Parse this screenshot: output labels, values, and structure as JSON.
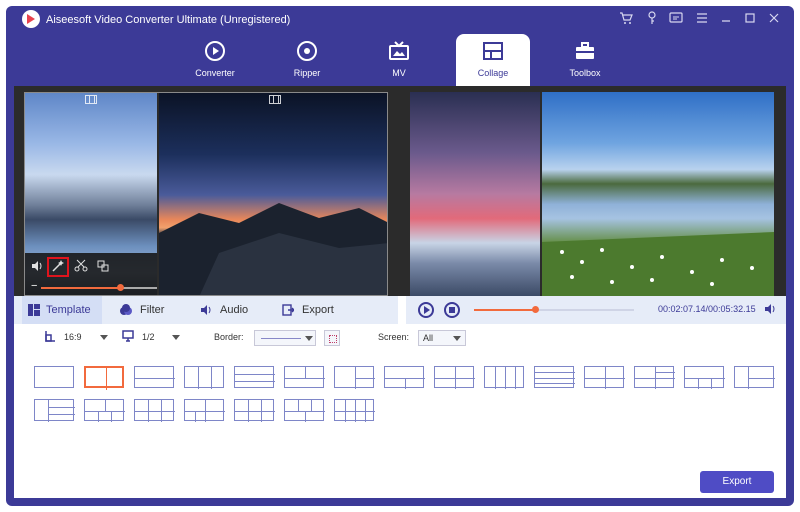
{
  "window": {
    "title": "Aiseesoft Video Converter Ultimate (Unregistered)"
  },
  "titlebar_icons": [
    "cart-icon",
    "key-icon",
    "feedback-icon",
    "menu-icon",
    "minimize-icon",
    "maximize-icon",
    "close-icon"
  ],
  "nav": {
    "tabs": [
      {
        "label": "Converter",
        "icon": "converter-icon"
      },
      {
        "label": "Ripper",
        "icon": "ripper-icon"
      },
      {
        "label": "MV",
        "icon": "mv-icon"
      },
      {
        "label": "Collage",
        "icon": "collage-icon",
        "active": true
      },
      {
        "label": "Toolbox",
        "icon": "toolbox-icon"
      }
    ]
  },
  "preview": {
    "edit_bar": {
      "icons": [
        "volume-icon",
        "magic-wand-icon",
        "scissors-icon",
        "crop-icon"
      ],
      "highlighted": "magic-wand-icon",
      "volume_level": 0.6
    }
  },
  "bottom_tabs": [
    {
      "label": "Template",
      "icon": "template-icon",
      "active": true
    },
    {
      "label": "Filter",
      "icon": "filter-icon"
    },
    {
      "label": "Audio",
      "icon": "audio-icon"
    },
    {
      "label": "Export",
      "icon": "export-icon"
    }
  ],
  "player": {
    "time": "00:02:07.14/00:05:32.15",
    "progress": 0.38
  },
  "options": {
    "aspect_ratio": "16:9",
    "screen_split": "1/2",
    "border_label": "Border:",
    "screen_label": "Screen:",
    "screen_value": "All"
  },
  "templates": {
    "selected_index": 1,
    "count": 22
  },
  "export_button": "Export",
  "colors": {
    "accent": "#3c3a97",
    "highlight": "#f26a3d",
    "export_bg": "#4f4cc5",
    "selection_border": "#e0141d"
  }
}
